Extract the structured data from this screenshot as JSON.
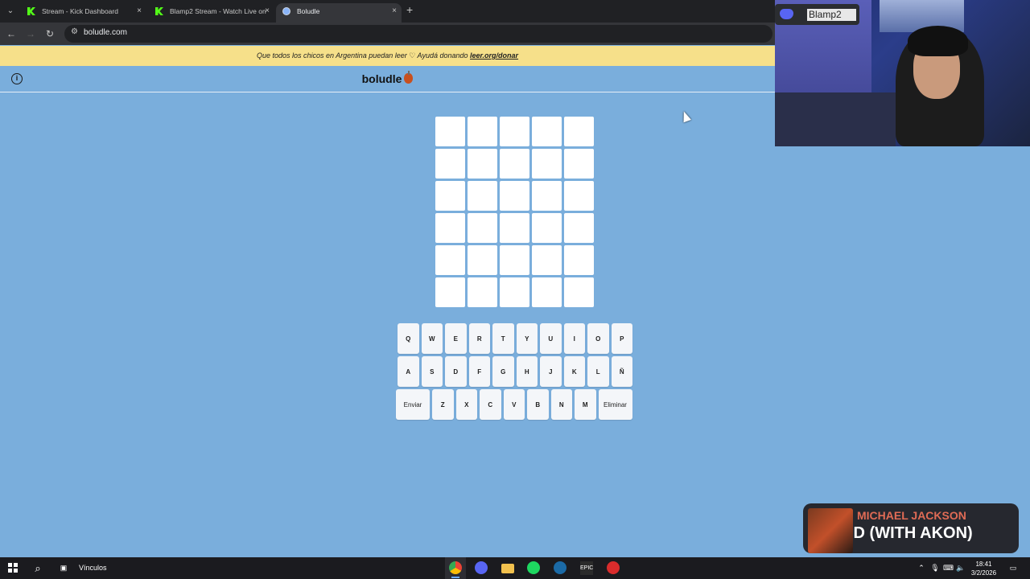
{
  "browser": {
    "tabs": [
      {
        "title": "Stream - Kick Dashboard",
        "favicon": "kick-icon",
        "active": false
      },
      {
        "title": "Blamp2 Stream - Watch Live on",
        "favicon": "kick-icon",
        "active": false
      },
      {
        "title": "Boludle",
        "favicon": "globe-icon",
        "active": true
      }
    ],
    "new_tab": "+",
    "close_glyph": "×",
    "url": "boludle.com"
  },
  "banner": {
    "text": "Que todos los chicos en Argentina puedan leer",
    "heart": "♡",
    "cta": "Ayudá donando",
    "link": "leer.org/donar"
  },
  "app": {
    "title": "boludle",
    "info_glyph": "i",
    "board_rows": 6,
    "board_cols": 5
  },
  "keyboard": {
    "row1": [
      "Q",
      "W",
      "E",
      "R",
      "T",
      "Y",
      "U",
      "I",
      "O",
      "P"
    ],
    "row2": [
      "A",
      "S",
      "D",
      "F",
      "G",
      "H",
      "J",
      "K",
      "L",
      "Ñ"
    ],
    "row3": [
      "Enviar",
      "Z",
      "X",
      "C",
      "V",
      "B",
      "N",
      "M",
      "Eliminar"
    ]
  },
  "overlay": {
    "discord_name": "Blamp2",
    "now_playing_artist": "MICHAEL JACKSON",
    "now_playing_track": "ID (WITH AKON)"
  },
  "taskbar": {
    "links_label": "Vínculos",
    "time": "18:41",
    "date": "3/2/2026"
  }
}
